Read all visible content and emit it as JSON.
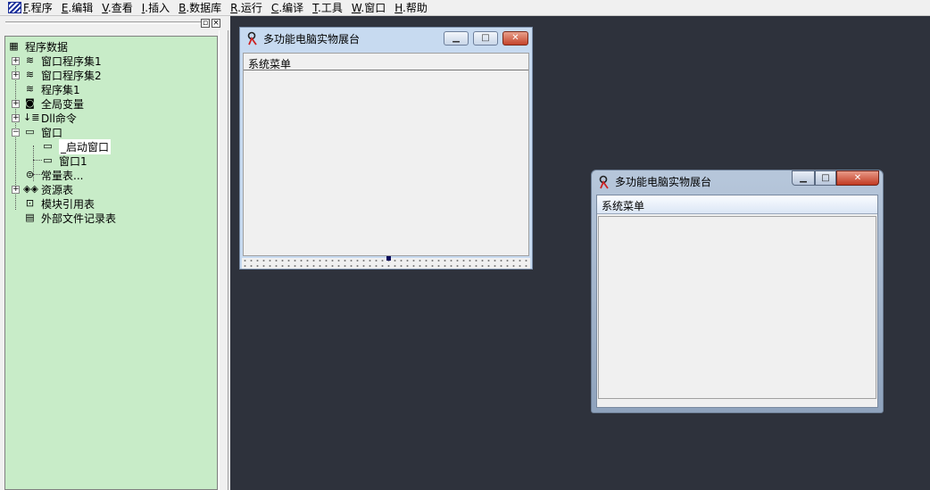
{
  "menubar": {
    "items": [
      {
        "key": "F",
        "label": ".程序"
      },
      {
        "key": "E",
        "label": ".编辑"
      },
      {
        "key": "V",
        "label": ".查看"
      },
      {
        "key": "I",
        "label": ".插入"
      },
      {
        "key": "B",
        "label": ".数据库"
      },
      {
        "key": "R",
        "label": ".运行"
      },
      {
        "key": "C",
        "label": ".编译"
      },
      {
        "key": "T",
        "label": ".工具"
      },
      {
        "key": "W",
        "label": ".窗口"
      },
      {
        "key": "H",
        "label": ".帮助"
      }
    ]
  },
  "tree": {
    "root": "程序数据",
    "items": [
      {
        "label": "窗口程序集1",
        "icon": "stack-icon"
      },
      {
        "label": "窗口程序集2",
        "icon": "stack-icon"
      },
      {
        "label": "程序集1",
        "icon": "stack-icon"
      },
      {
        "label": "全局变量",
        "icon": "variable-icon"
      },
      {
        "label": "Dll命令",
        "icon": "dll-icon"
      },
      {
        "label": "窗口",
        "icon": "window-icon"
      },
      {
        "label": "_启动窗口",
        "icon": "window-icon"
      },
      {
        "label": "窗口1",
        "icon": "window-icon"
      },
      {
        "label": "常量表...",
        "icon": "constant-icon"
      },
      {
        "label": "资源表",
        "icon": "resource-icon"
      },
      {
        "label": "模块引用表",
        "icon": "module-icon"
      },
      {
        "label": "外部文件记录表",
        "icon": "file-icon"
      }
    ]
  },
  "designer_window": {
    "title": "多功能电脑实物展台",
    "menu": "系统菜单"
  },
  "runtime_window": {
    "title": "多功能电脑实物展台",
    "menu": "系统菜单"
  },
  "colors": {
    "tree_background": "#c8ecc8",
    "workspace": "#2e323c"
  }
}
